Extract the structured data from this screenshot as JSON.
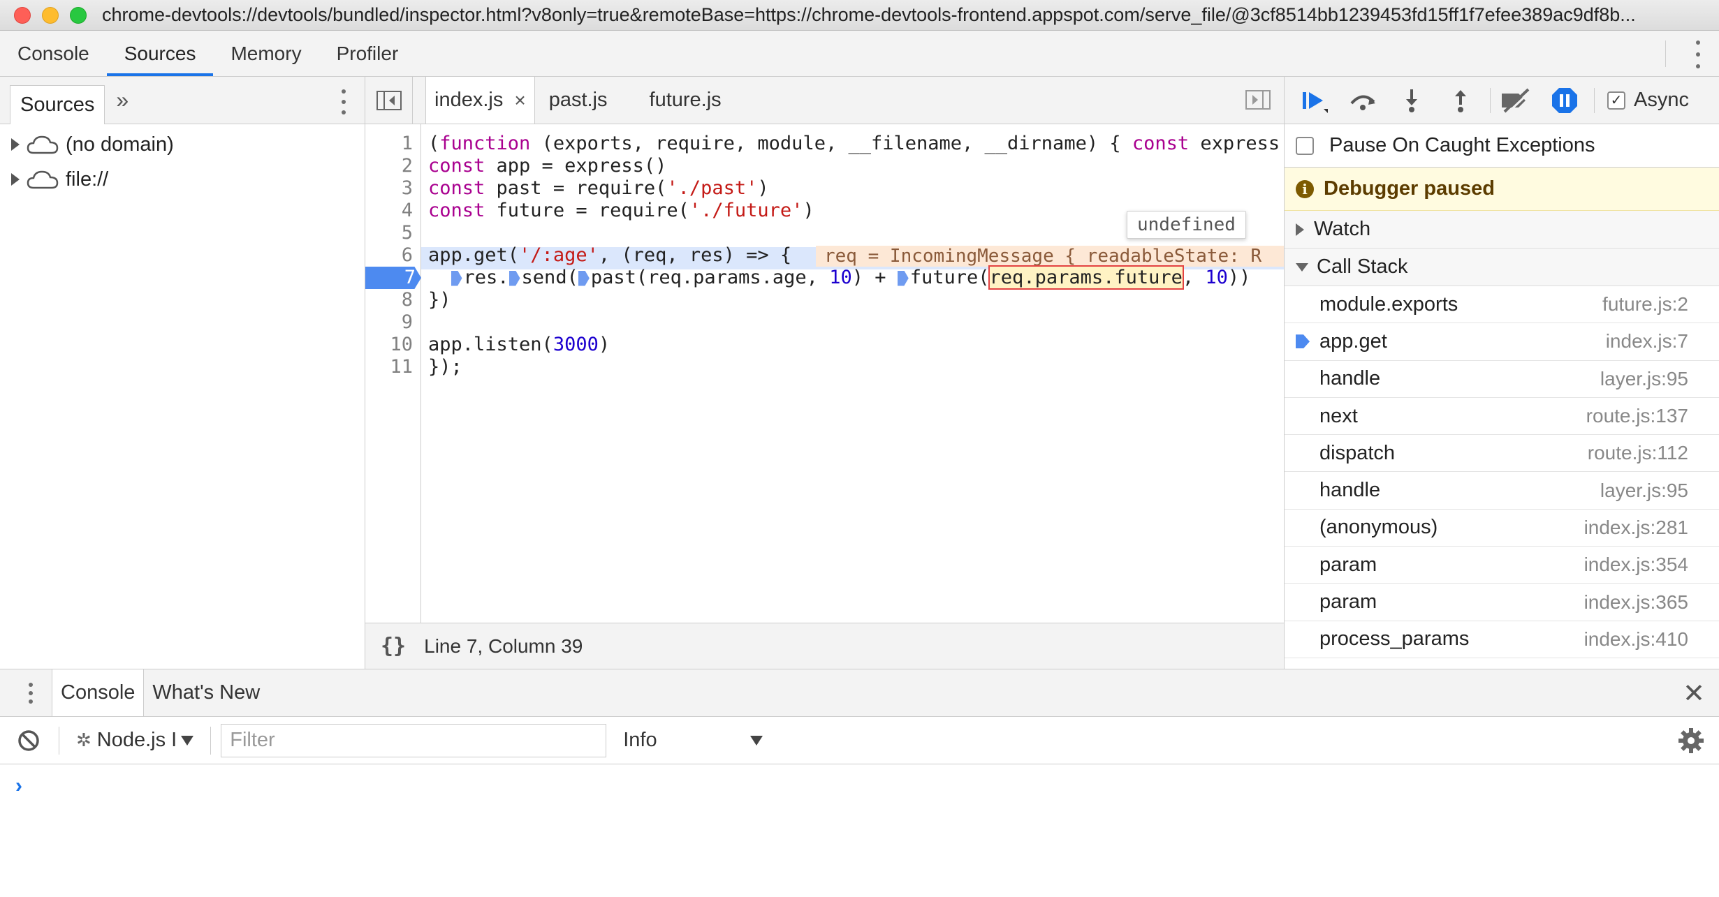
{
  "window": {
    "title": "chrome-devtools://devtools/bundled/inspector.html?v8only=true&remoteBase=https://chrome-devtools-frontend.appspot.com/serve_file/@3cf8514bb1239453fd15ff1f7efee389ac9df8b..."
  },
  "main_tabs": [
    {
      "label": "Console"
    },
    {
      "label": "Sources"
    },
    {
      "label": "Memory"
    },
    {
      "label": "Profiler"
    }
  ],
  "navigator": {
    "tab_label": "Sources",
    "more_label": "»",
    "tree": [
      {
        "label": "(no domain)"
      },
      {
        "label": "file://"
      }
    ]
  },
  "editor": {
    "tabs": [
      {
        "label": "index.js",
        "close": "×"
      },
      {
        "label": "past.js"
      },
      {
        "label": "future.js"
      }
    ],
    "line_numbers": [
      "1",
      "2",
      "3",
      "4",
      "5",
      "6",
      "7",
      "8",
      "9",
      "10",
      "11"
    ],
    "execution_line": "7",
    "inline_value": "req = IncomingMessage { readableState: R",
    "tooltip": "undefined",
    "status": {
      "pretty_print": "{}",
      "position": "Line 7, Column 39"
    }
  },
  "debugger": {
    "async_label": "Async",
    "async_checked": true,
    "pause_on_caught_label": "Pause On Caught Exceptions",
    "paused_message": "Debugger paused",
    "watch_label": "Watch",
    "call_stack_label": "Call Stack",
    "call_stack": [
      {
        "name": "module.exports",
        "location": "future.js:2"
      },
      {
        "name": "app.get",
        "location": "index.js:7",
        "current": true
      },
      {
        "name": "handle",
        "location": "layer.js:95"
      },
      {
        "name": "next",
        "location": "route.js:137"
      },
      {
        "name": "dispatch",
        "location": "route.js:112"
      },
      {
        "name": "handle",
        "location": "layer.js:95"
      },
      {
        "name": "(anonymous)",
        "location": "index.js:281"
      },
      {
        "name": "param",
        "location": "index.js:354"
      },
      {
        "name": "param",
        "location": "index.js:365"
      },
      {
        "name": "process_params",
        "location": "index.js:410"
      }
    ]
  },
  "drawer": {
    "tabs": [
      {
        "label": "Console"
      },
      {
        "label": "What's New"
      }
    ],
    "close": "✕",
    "context": "Node.js I",
    "filter_placeholder": "Filter",
    "level": "Info",
    "prompt": "›"
  },
  "colors": {
    "accent": "#1a73e8",
    "execution_line": "#4d8af0",
    "paused_banner": "#fffbe0",
    "keyword": "#a9008f",
    "string": "#c41a16",
    "number": "#1c00cf"
  }
}
